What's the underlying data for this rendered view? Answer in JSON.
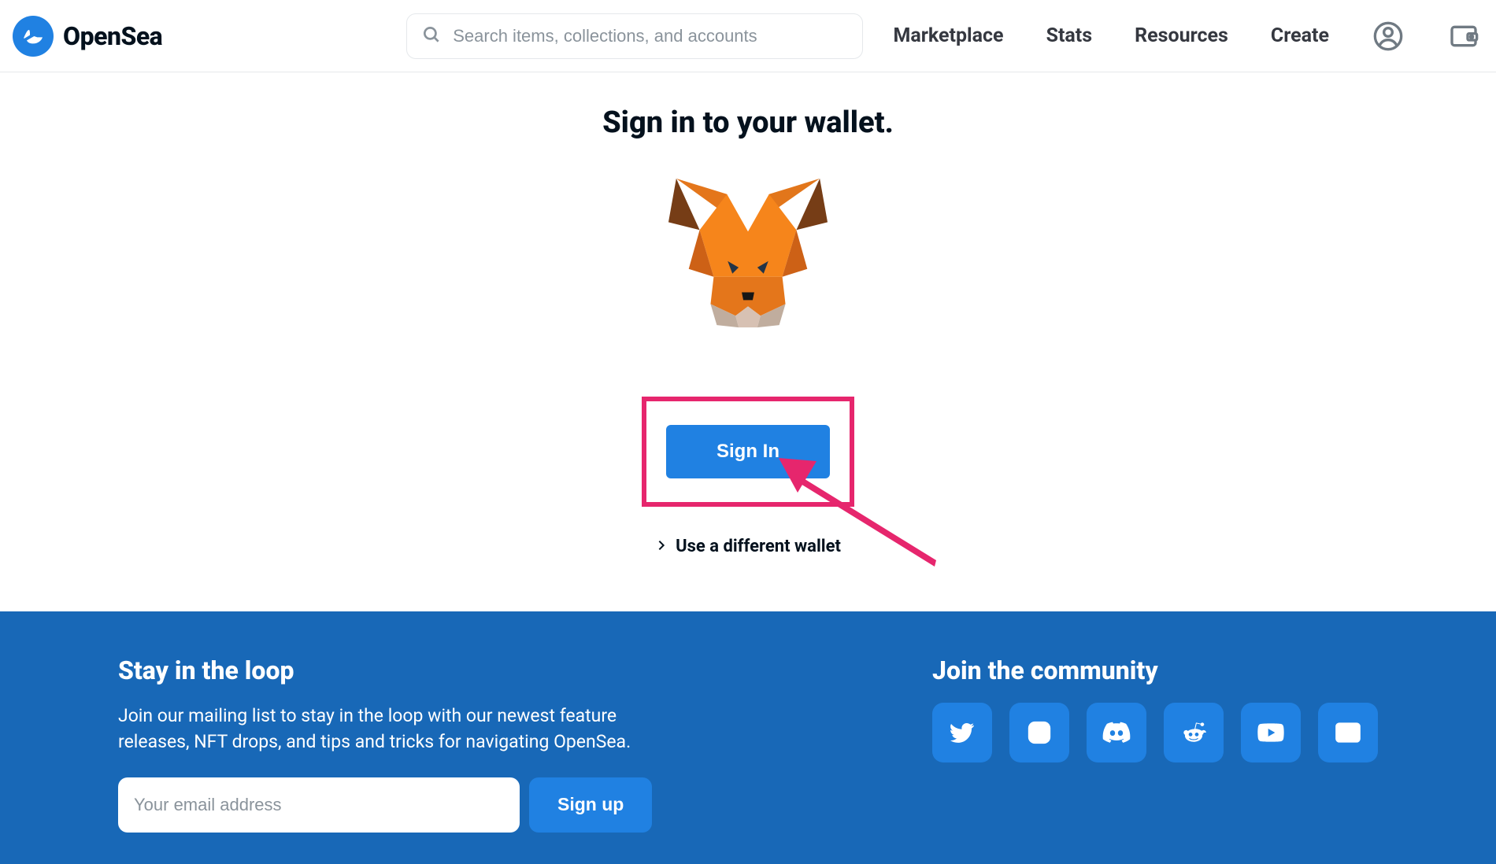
{
  "header": {
    "brand_name": "OpenSea",
    "search_placeholder": "Search items, collections, and accounts",
    "nav": {
      "marketplace": "Marketplace",
      "stats": "Stats",
      "resources": "Resources",
      "create": "Create"
    }
  },
  "main": {
    "title": "Sign in to your wallet.",
    "wallet_icon": "metamask-fox",
    "sign_in_label": "Sign In",
    "different_wallet_label": "Use a different wallet",
    "annotation_color": "#E6266D"
  },
  "footer": {
    "loop": {
      "title": "Stay in the loop",
      "description": "Join our mailing list to stay in the loop with our newest feature releases, NFT drops, and tips and tricks for navigating OpenSea.",
      "email_placeholder": "Your email address",
      "signup_label": "Sign up"
    },
    "community": {
      "title": "Join the community",
      "socials": [
        "twitter",
        "instagram",
        "discord",
        "reddit",
        "youtube",
        "mail"
      ]
    }
  },
  "colors": {
    "brand_blue": "#2081E2",
    "footer_blue": "#1868B7",
    "annotation_pink": "#E6266D"
  }
}
